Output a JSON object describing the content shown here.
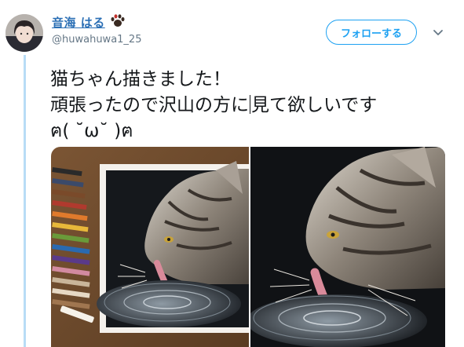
{
  "user": {
    "display_name": "音海 はる",
    "handle": "@huwahuwa1_25",
    "avatar_icon": "user-avatar",
    "badge_icon": "paw-print-icon"
  },
  "follow_button": {
    "label": "フォローする"
  },
  "menu": {
    "icon": "chevron-down-icon"
  },
  "tweet": {
    "line1": "猫ちゃん描きました！",
    "line2_before_caret": "頑張ったので沢山の方に",
    "line2_after_caret": "見て欲しいです",
    "line3": "ฅ( ˘ω˘ )ฅ"
  },
  "media": {
    "photos": [
      {
        "subject": "colored-pencil-cat-drawing-with-pencils"
      },
      {
        "subject": "colored-pencil-cat-drawing-closeup"
      }
    ]
  },
  "colors": {
    "accent": "#1da1f2",
    "name_link": "#2b6fb5",
    "thread_line": "#b8dcf6",
    "handle_gray": "#657786"
  }
}
